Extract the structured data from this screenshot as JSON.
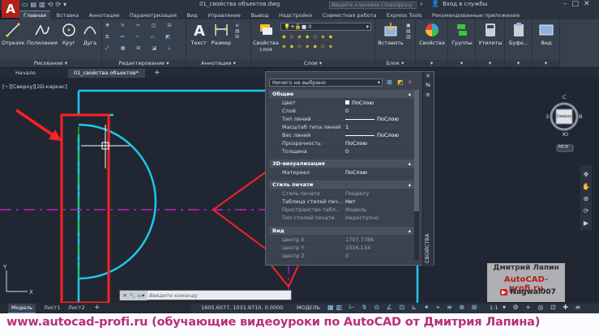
{
  "app": {
    "logo": "A",
    "document_title": "01_свойства объектов.dwg",
    "search_placeholder": "Введите ключевое слово/фразу",
    "signin": "Вход в службы"
  },
  "ribbon_tabs": [
    "Главная",
    "Вставка",
    "Аннотации",
    "Параметризация",
    "Вид",
    "Управление",
    "Вывод",
    "Надстройки",
    "Совместная работа",
    "Express Tools",
    "Рекомендованные приложения"
  ],
  "ribbon": {
    "draw_tools": [
      "Отрезок",
      "Полилиния",
      "Круг",
      "Дуга"
    ],
    "draw_title": "Рисование",
    "modify_title": "Редактирование",
    "annot_tools": [
      "Текст",
      "Размер"
    ],
    "annot_title": "Аннотации",
    "layer_props": "Свойства слоя",
    "layer_current": "0",
    "layers_title": "Слои",
    "insert": "Вставить",
    "block_title": "Блок",
    "properties": "Свойства",
    "groups": "Группы",
    "utilities": "Утилиты",
    "clipboard": "Буфе...",
    "view": "Вид"
  },
  "file_tabs": [
    "Начало",
    "01_свойства объектов*"
  ],
  "viewport_label": "[−][Сверху][2D-каркас]",
  "viewcube": {
    "top": "С",
    "face": "Сверху",
    "right": "В",
    "bottom": "Ю",
    "left": "З",
    "wcs": "МСК"
  },
  "properties_panel": {
    "selection": "Ничего не выбрано",
    "side_label": "СВОЙСТВА",
    "sections": [
      {
        "title": "Общие",
        "rows": [
          {
            "key": "Цвет",
            "value": "ПоСлою",
            "swatch": true
          },
          {
            "key": "Слой",
            "value": "0"
          },
          {
            "key": "Тип линий",
            "value": "ПоСлою",
            "line": true
          },
          {
            "key": "Масштаб типа линий",
            "value": "1"
          },
          {
            "key": "Вес линий",
            "value": "ПоСлою",
            "line": true
          },
          {
            "key": "Прозрачность",
            "value": "ПоСлою"
          },
          {
            "key": "Толщина",
            "value": "0"
          }
        ]
      },
      {
        "title": "3D-визуализация",
        "rows": [
          {
            "key": "Материал",
            "value": "ПоСлою"
          }
        ]
      },
      {
        "title": "Стиль печати",
        "rows": [
          {
            "key": "Стиль печати",
            "value": "ПоЦвету",
            "dim": true
          },
          {
            "key": "Таблица стилей печ...",
            "value": "Нет"
          },
          {
            "key": "Пространство табл...",
            "value": "Модель",
            "dim": true
          },
          {
            "key": "Тип стилей печати",
            "value": "Недоступно",
            "dim": true
          }
        ]
      },
      {
        "title": "Вид",
        "rows": [
          {
            "key": "Центр X",
            "value": "1707.7786",
            "dim": true
          },
          {
            "key": "Центр Y",
            "value": "1016.134",
            "dim": true
          },
          {
            "key": "Центр Z",
            "value": "0",
            "dim": true
          }
        ]
      }
    ]
  },
  "command_placeholder": "Введите команду",
  "layout_tabs": [
    "Модель",
    "Лист1",
    "Лист2"
  ],
  "status": {
    "coords": "1605.6077, 1031.9710, 0.0000",
    "mode": "МОДЕЛЬ",
    "scale": "1:1"
  },
  "watermark": {
    "name": "Дмитрий Лапин",
    "site": "AutoCAD-profi.ru",
    "youtube": "Nagwal007"
  },
  "banner": "www.autocad-profi.ru  (обучающие видеоуроки по AutoCAD от Дмитрия Лапина)",
  "colors": {
    "cyan": "#1ec8e8",
    "red": "#ff2020",
    "magenta": "#c020c0",
    "green": "#20c020",
    "accent": "#ba2e77"
  }
}
